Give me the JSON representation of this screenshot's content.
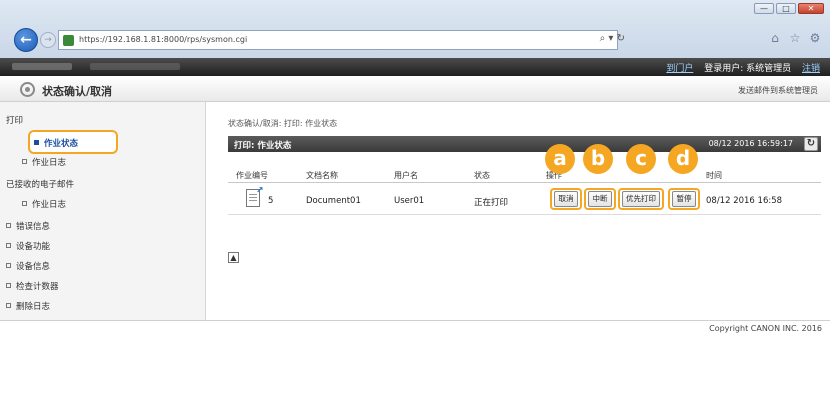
{
  "browser": {
    "url": "https://192.168.1.81:8000/rps/sysmon.cgi",
    "search_icon": "search-refresh-icon",
    "win_buttons": [
      "—",
      "□",
      "✕"
    ]
  },
  "topbar": {
    "portal": "到门户",
    "user_label": "登录用户: 系统管理员",
    "logout": "注销"
  },
  "header": {
    "title": "状态确认/取消",
    "right_link": "发送邮件到系统管理员"
  },
  "sidebar": {
    "print_category": "打印",
    "job_status": "作业状态",
    "job_log": "作业日志",
    "received_category": "已接收的电子邮件",
    "received_job_log": "作业日志",
    "items": [
      "错误信息",
      "设备功能",
      "设备信息",
      "检查计数器",
      "删除日志"
    ]
  },
  "main": {
    "breadcrumb": "状态确认/取消: 打印: 作业状态",
    "section_title": "打印: 作业状态",
    "timestamp": "08/12 2016 16:59:17",
    "columns": {
      "job_no": "作业编号",
      "doc_name": "文档名称",
      "user_name": "用户名",
      "status": "状态",
      "operation": "操作",
      "time": "时间"
    },
    "row": {
      "job_no": "5",
      "doc_name": "Document01",
      "user_name": "User01",
      "status": "正在打印",
      "time": "08/12 2016 16:58"
    },
    "buttons": {
      "cancel": "取消",
      "interrupt": "中断",
      "priority": "优先打印",
      "pause": "暂停"
    },
    "badges": [
      "a",
      "b",
      "c",
      "d"
    ]
  },
  "footer": {
    "copyright": "Copyright CANON INC. 2016"
  }
}
